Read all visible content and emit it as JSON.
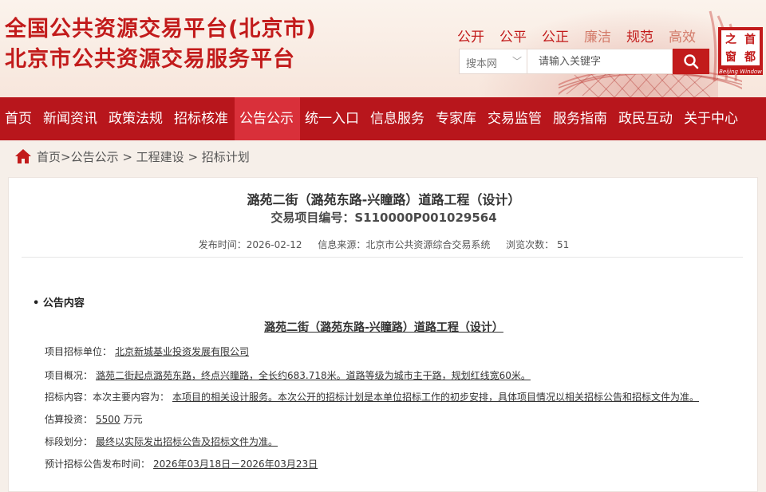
{
  "header": {
    "title_line1": "全国公共资源交易平台(北京市)",
    "title_line2": "北京市公共资源交易服务平台",
    "values": [
      "公开",
      "公平",
      "公正",
      "廉洁",
      "规范",
      "高效"
    ],
    "logo": {
      "chars": [
        "首",
        "之",
        "都",
        "窗"
      ],
      "sub": "Beijing Window"
    },
    "brand_color": "#c21b1b"
  },
  "search": {
    "scope": "搜本网",
    "placeholder": "请输入关键字"
  },
  "nav": {
    "items": [
      "首页",
      "新闻资讯",
      "政策法规",
      "招标核准",
      "公告公示",
      "统一入口",
      "信息服务",
      "专家库",
      "交易监管",
      "服务指南",
      "政民互动",
      "关于中心"
    ],
    "active_index": 4,
    "bg_color": "#b8161c",
    "active_color": "#d9303a"
  },
  "breadcrumb": {
    "home": "首页>",
    "path": "公告公示 > 工程建设 > 招标计划"
  },
  "article": {
    "title": "潞苑二街（潞苑东路-兴瞳路）道路工程（设计）",
    "code_label": "交易项目编号：",
    "code_value": "S110000P001029564",
    "published": "发布时间：2026-02-12",
    "source": "信息来源：北京市公共资源综合交易系统",
    "views": "浏览次数：  51",
    "section_heading": "• 公告内容",
    "inner_title": "潞苑二街（潞苑东路-兴瞳路）道路工程（设计）",
    "rows": [
      {
        "label": "项目招标单位：",
        "value": "北京新城基业投资发展有限公司"
      },
      {
        "label": "项目概况：",
        "value": "潞苑二街起点潞苑东路，终点兴瞳路，全长约683.718米。道路等级为城市主干路，规划红线宽60米。"
      },
      {
        "label": "招标内容：本次主要内容为：",
        "value": "本项目的相关设计服务。本次公开的招标计划是本单位招标工作的初步安排，具体项目情况以相关招标公告和招标文件为准。"
      },
      {
        "label": "估算投资：",
        "value": "5500",
        "suffix": "万元"
      },
      {
        "label": "标段划分：",
        "value": "最终以实际发出招标公告及招标文件为准。"
      },
      {
        "label": "预计招标公告发布时间：",
        "value": "2026年03月18日－2026年03月23日"
      }
    ]
  }
}
